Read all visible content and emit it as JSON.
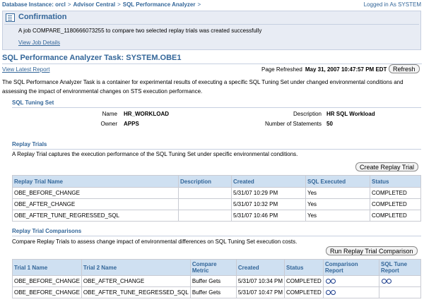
{
  "breadcrumb": {
    "items": [
      "Database Instance: orcl",
      "Advisor Central",
      "SQL Performance Analyzer"
    ],
    "separator": ">"
  },
  "user": {
    "logged_in": "Logged in As SYSTEM"
  },
  "confirmation": {
    "title": "Confirmation",
    "message": "A job COMPARE_1180666073255 to compare two selected replay trials was created successfully",
    "link": "View Job Details"
  },
  "task": {
    "title": "SQL Performance Analyzer Task: SYSTEM.OBE1",
    "view_latest_report": "View Latest Report",
    "page_refreshed_label": "Page Refreshed",
    "page_refreshed_value": "May 31, 2007 10:47:57 PM EDT",
    "refresh_label": "Refresh",
    "description": "The SQL Performance Analyzer Task is a container for experimental results of executing a specific SQL Tuning Set under changed environmental conditions and assessing the impact of environmental changes on STS execution performance."
  },
  "sql_tuning_set": {
    "header": "SQL Tuning Set",
    "name_label": "Name",
    "name_value": "HR_WORKLOAD",
    "owner_label": "Owner",
    "owner_value": "APPS",
    "description_label": "Description",
    "description_value": "HR SQL Workload",
    "statements_label": "Number of Statements",
    "statements_value": "50"
  },
  "replay_trials": {
    "header": "Replay Trials",
    "description": "A Replay Trial captures the execution performance of the SQL Tuning Set under specific environmental conditions.",
    "create_button": "Create Replay Trial",
    "columns": [
      "Replay Trial Name",
      "Description",
      "Created",
      "SQL Executed",
      "Status"
    ],
    "rows": [
      [
        "OBE_BEFORE_CHANGE",
        "",
        "5/31/07 10:29 PM",
        "Yes",
        "COMPLETED"
      ],
      [
        "OBE_AFTER_CHANGE",
        "",
        "5/31/07 10:32 PM",
        "Yes",
        "COMPLETED"
      ],
      [
        "OBE_AFTER_TUNE_REGRESSED_SQL",
        "",
        "5/31/07 10:46 PM",
        "Yes",
        "COMPLETED"
      ]
    ]
  },
  "comparisons": {
    "header": "Replay Trial Comparisons",
    "description": "Compare Replay Trials to assess change impact of environmental differences on SQL Tuning Set execution costs.",
    "run_button": "Run Replay Trial Comparison",
    "columns": [
      "Trial 1 Name",
      "Trial 2 Name",
      "Compare Metric",
      "Created",
      "Status",
      "Comparison Report",
      "SQL Tune Report"
    ],
    "rows": [
      [
        "OBE_BEFORE_CHANGE",
        "OBE_AFTER_CHANGE",
        "Buffer Gets",
        "5/31/07 10:34 PM",
        "COMPLETED"
      ],
      [
        "OBE_BEFORE_CHANGE",
        "OBE_AFTER_TUNE_REGRESSED_SQL",
        "Buffer Gets",
        "5/31/07 10:47 PM",
        "COMPLETED"
      ]
    ],
    "report_icon": "glasses-icon"
  },
  "colors": {
    "accent": "#336699",
    "header_bg": "#cfe0f1",
    "confirm_bg": "#e8ecf4"
  }
}
